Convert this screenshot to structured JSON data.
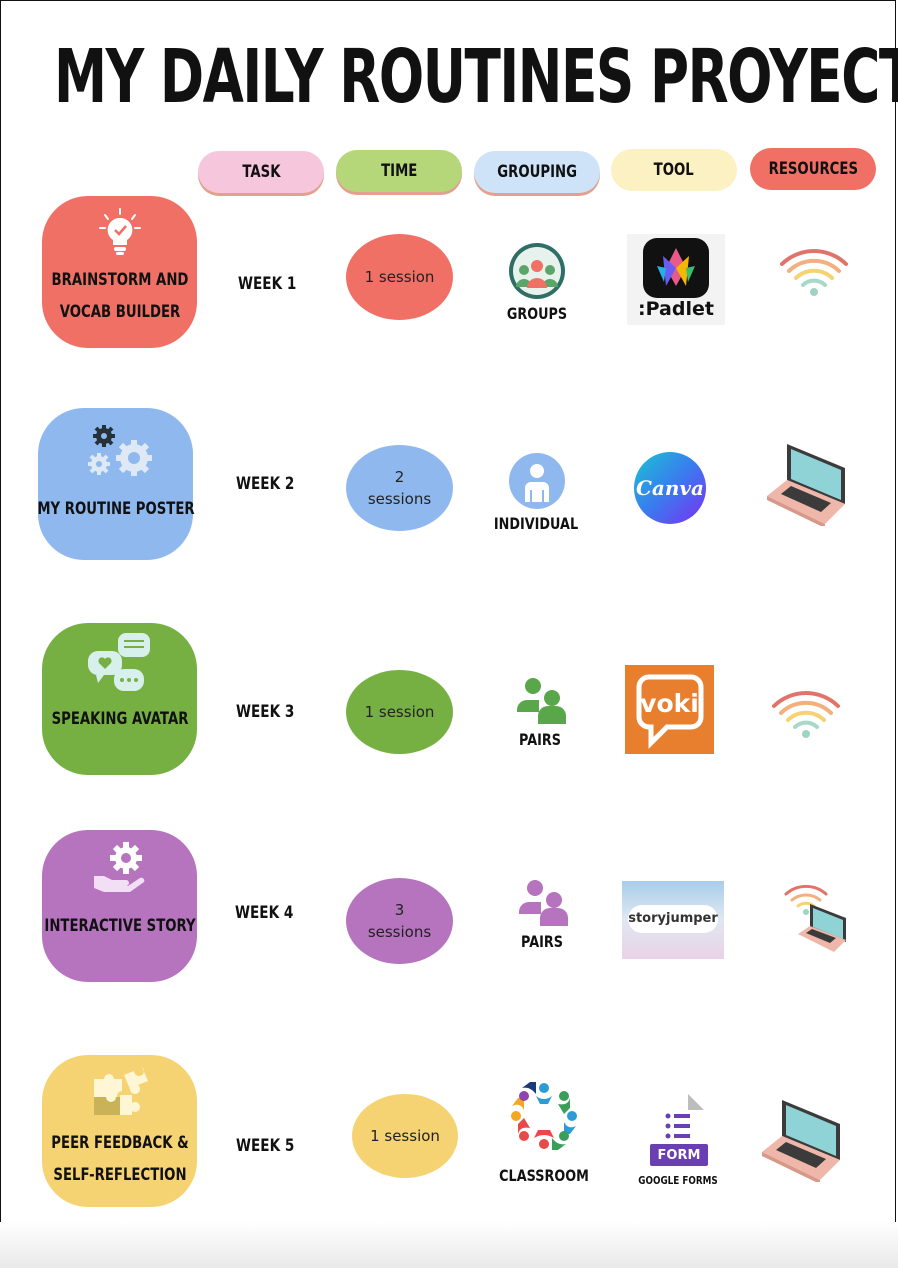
{
  "title": "MY DAILY ROUTINES PROYECT",
  "headers": {
    "task": "TASK",
    "time": "TIME",
    "grouping": "GROUPING",
    "tool": "TOOL",
    "resources": "RESOURCES"
  },
  "colors": {
    "task_header": "#f5c6dc",
    "time_header": "#b5d77a",
    "grouping_header": "#cfe3f8",
    "tool_header": "#fbf1c2",
    "resources_header": "#f07065",
    "red": "#f07065",
    "blue": "#8fb8ee",
    "green": "#76b043",
    "purple": "#b574bd",
    "yellow": "#f5d272"
  },
  "rows": [
    {
      "task_line1": "BRAINSTORM AND",
      "task_line2": "VOCAB BUILDER",
      "week": "WEEK 1",
      "time_line1": "1 session",
      "time_line2": "",
      "grouping": "GROUPS",
      "tool": ":Padlet",
      "icon": "lightbulb-icon",
      "resource": "wifi-icon"
    },
    {
      "task_line1": "MY ROUTINE POSTER",
      "task_line2": "",
      "week": "WEEK 2",
      "time_line1": "2",
      "time_line2": "sessions",
      "grouping": "INDIVIDUAL",
      "tool": "Canva",
      "icon": "gears-icon",
      "resource": "laptop-icon"
    },
    {
      "task_line1": "SPEAKING AVATAR",
      "task_line2": "",
      "week": "WEEK 3",
      "time_line1": "1 session",
      "time_line2": "",
      "grouping": "PAIRS",
      "tool": "voki",
      "icon": "chat-bubbles-icon",
      "resource": "wifi-icon"
    },
    {
      "task_line1": "INTERACTIVE STORY",
      "task_line2": "",
      "week": "WEEK 4",
      "time_line1": "3",
      "time_line2": "sessions",
      "grouping": "PAIRS",
      "tool": "storyjumper",
      "icon": "gear-hand-icon",
      "resource": "wifi-laptop-icon"
    },
    {
      "task_line1": "PEER FEEDBACK &",
      "task_line2": "SELF-REFLECTION",
      "week": "WEEK 5",
      "time_line1": "1 session",
      "time_line2": "",
      "grouping": "CLASSROOM",
      "tool": "FORM",
      "tool_caption": "GOOGLE FORMS",
      "icon": "puzzle-icon",
      "resource": "laptop-icon"
    }
  ]
}
